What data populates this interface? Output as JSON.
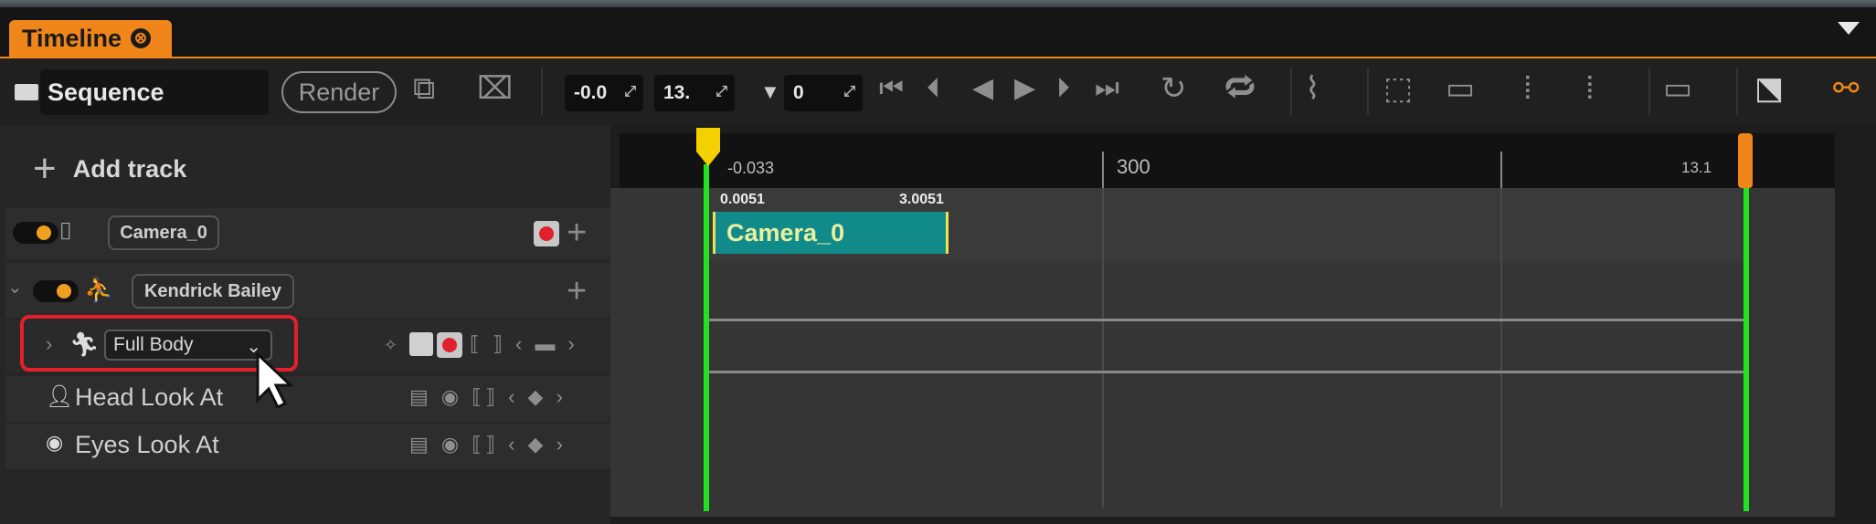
{
  "tab": {
    "title": "Timeline",
    "close": "⊗"
  },
  "toolbar": {
    "sequence_label": "Sequence",
    "render_label": "Render",
    "start_value": "-0.0",
    "end_value": "13.",
    "filter_value": "0"
  },
  "left": {
    "add_track_label": "Add track",
    "camera_label": "Camera_0",
    "character_label": "Kendrick Bailey",
    "fullbody_select": "Full Body",
    "head_look_label": "Head Look At",
    "eyes_look_label": "Eyes Look At"
  },
  "ruler": {
    "start_label": "-0.033",
    "mid_label": "300",
    "end_label": "13.1"
  },
  "clip": {
    "label": "Camera_0",
    "start": "0.0051",
    "end": "3.0051"
  },
  "colors": {
    "accent": "#f0851a",
    "clip": "#118a8a",
    "playhead": "#f5d000",
    "range_marker": "#22e322",
    "record": "#e0202a"
  }
}
